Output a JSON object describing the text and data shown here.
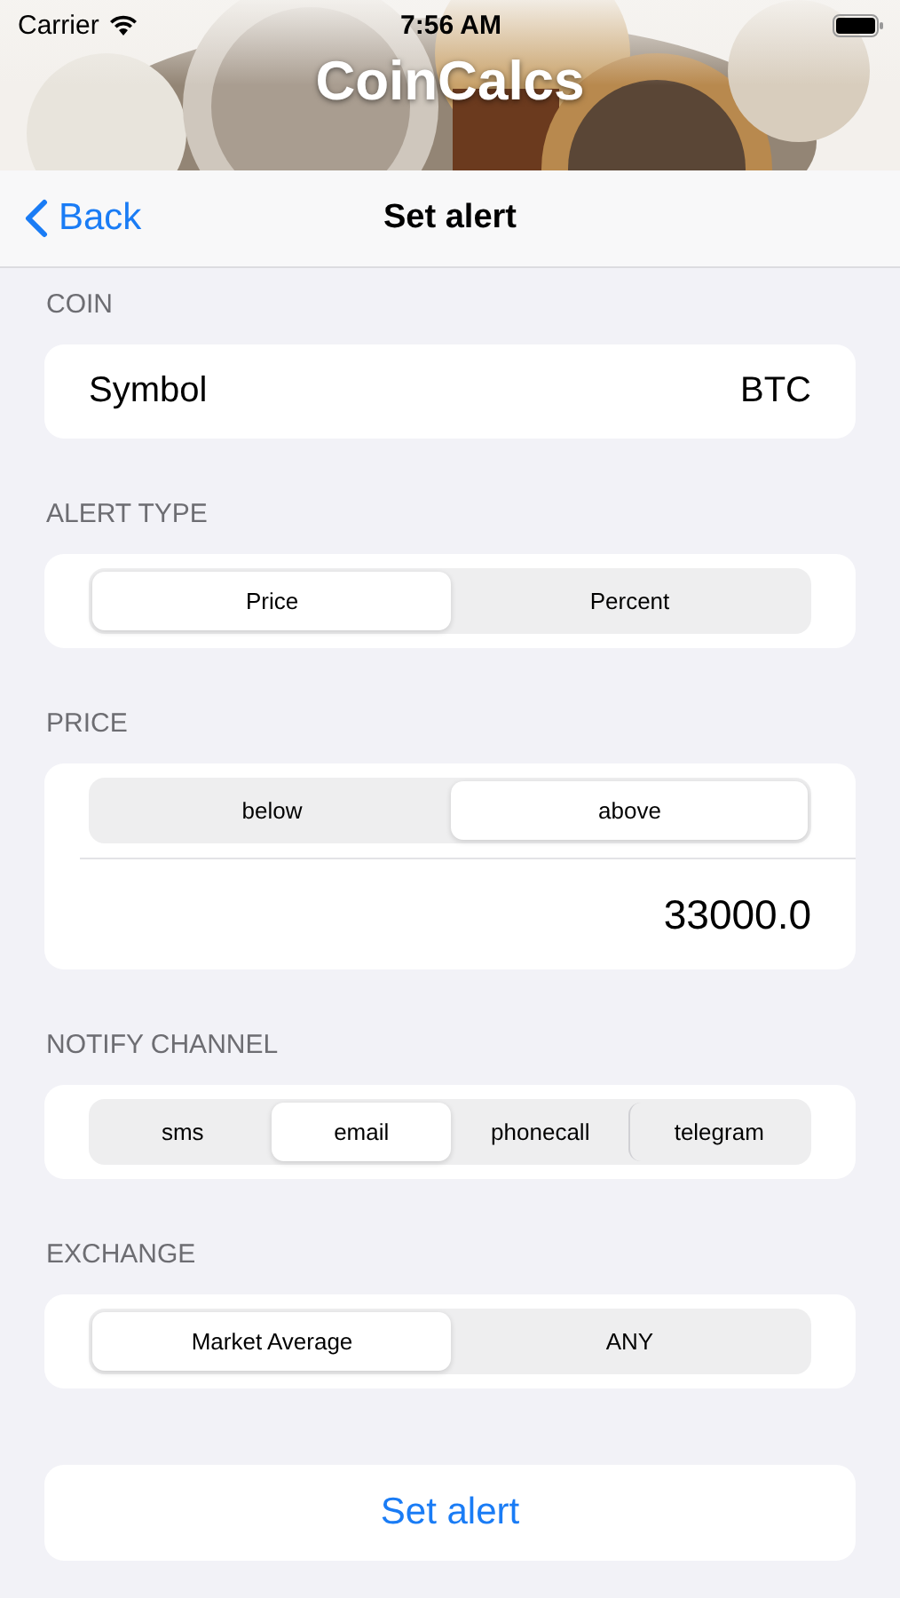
{
  "status_bar": {
    "carrier": "Carrier",
    "time": "7:56 AM"
  },
  "header": {
    "title": "CoinCalcs"
  },
  "nav_bar": {
    "back": "Back",
    "title": "Set alert"
  },
  "sections": [
    {
      "kind": "row",
      "label": "COIN",
      "row_label": "Symbol",
      "row_value": "BTC"
    },
    {
      "kind": "segmented",
      "label": "ALERT TYPE",
      "options": [
        {
          "label": "Price",
          "selected": true
        },
        {
          "label": "Percent",
          "selected": false
        }
      ]
    },
    {
      "kind": "segmented_value",
      "label": "PRICE",
      "options": [
        {
          "label": "below",
          "selected": false
        },
        {
          "label": "above",
          "selected": true
        }
      ],
      "value": "33000.0"
    },
    {
      "kind": "segmented",
      "label": "NOTIFY CHANNEL",
      "options": [
        {
          "label": "sms",
          "selected": false
        },
        {
          "label": "email",
          "selected": true
        },
        {
          "label": "phonecall",
          "selected": false
        },
        {
          "label": "telegram",
          "selected": false
        }
      ]
    },
    {
      "kind": "segmented",
      "label": "EXCHANGE",
      "options": [
        {
          "label": "Market Average",
          "selected": true
        },
        {
          "label": "ANY",
          "selected": false
        }
      ]
    }
  ],
  "submit_button": "Set alert"
}
